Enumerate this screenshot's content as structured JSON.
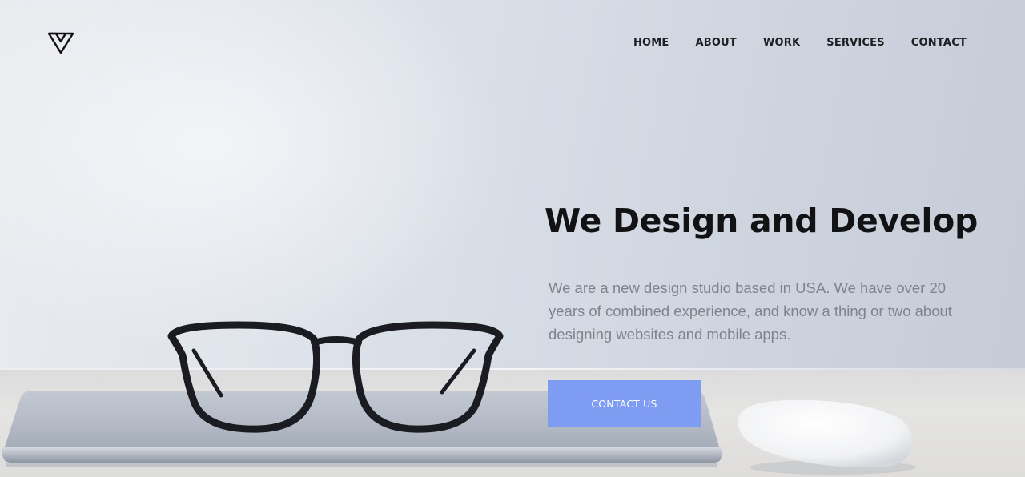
{
  "brand": {
    "logo_icon": "triangle-logo-icon"
  },
  "nav": {
    "items": [
      {
        "label": "HOME"
      },
      {
        "label": "ABOUT"
      },
      {
        "label": "WORK"
      },
      {
        "label": "SERVICES"
      },
      {
        "label": "CONTACT"
      }
    ]
  },
  "hero": {
    "title": "We Design and Develop",
    "description": "We are a new design studio based in USA. We have over 20 years of combined experience, and know a thing or two about designing websites and mobile apps.",
    "cta_label": "CONTACT US"
  },
  "colors": {
    "accent": "#7e9cf1",
    "title": "#121214",
    "body_text": "#7f848c"
  }
}
